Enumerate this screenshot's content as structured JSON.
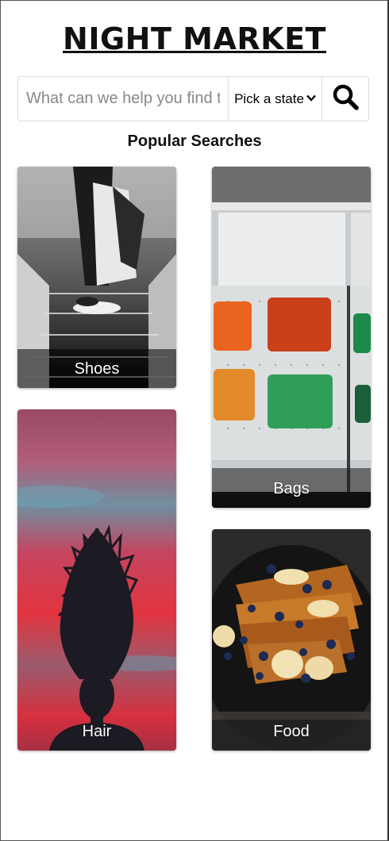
{
  "header": {
    "logo": "NIGHT MARKET"
  },
  "search": {
    "placeholder": "What can we help you find today?",
    "state_label": "Pick a state",
    "button_icon": "search-icon"
  },
  "popular": {
    "title": "Popular Searches",
    "cards": [
      {
        "label": "Shoes",
        "image": "escalator-sneakers-photo"
      },
      {
        "label": "Bags",
        "image": "colorful-bags-wall-photo"
      },
      {
        "label": "Hair",
        "image": "hair-silhouette-sunset-photo"
      },
      {
        "label": "Food",
        "image": "french-toast-blueberries-photo"
      }
    ]
  }
}
